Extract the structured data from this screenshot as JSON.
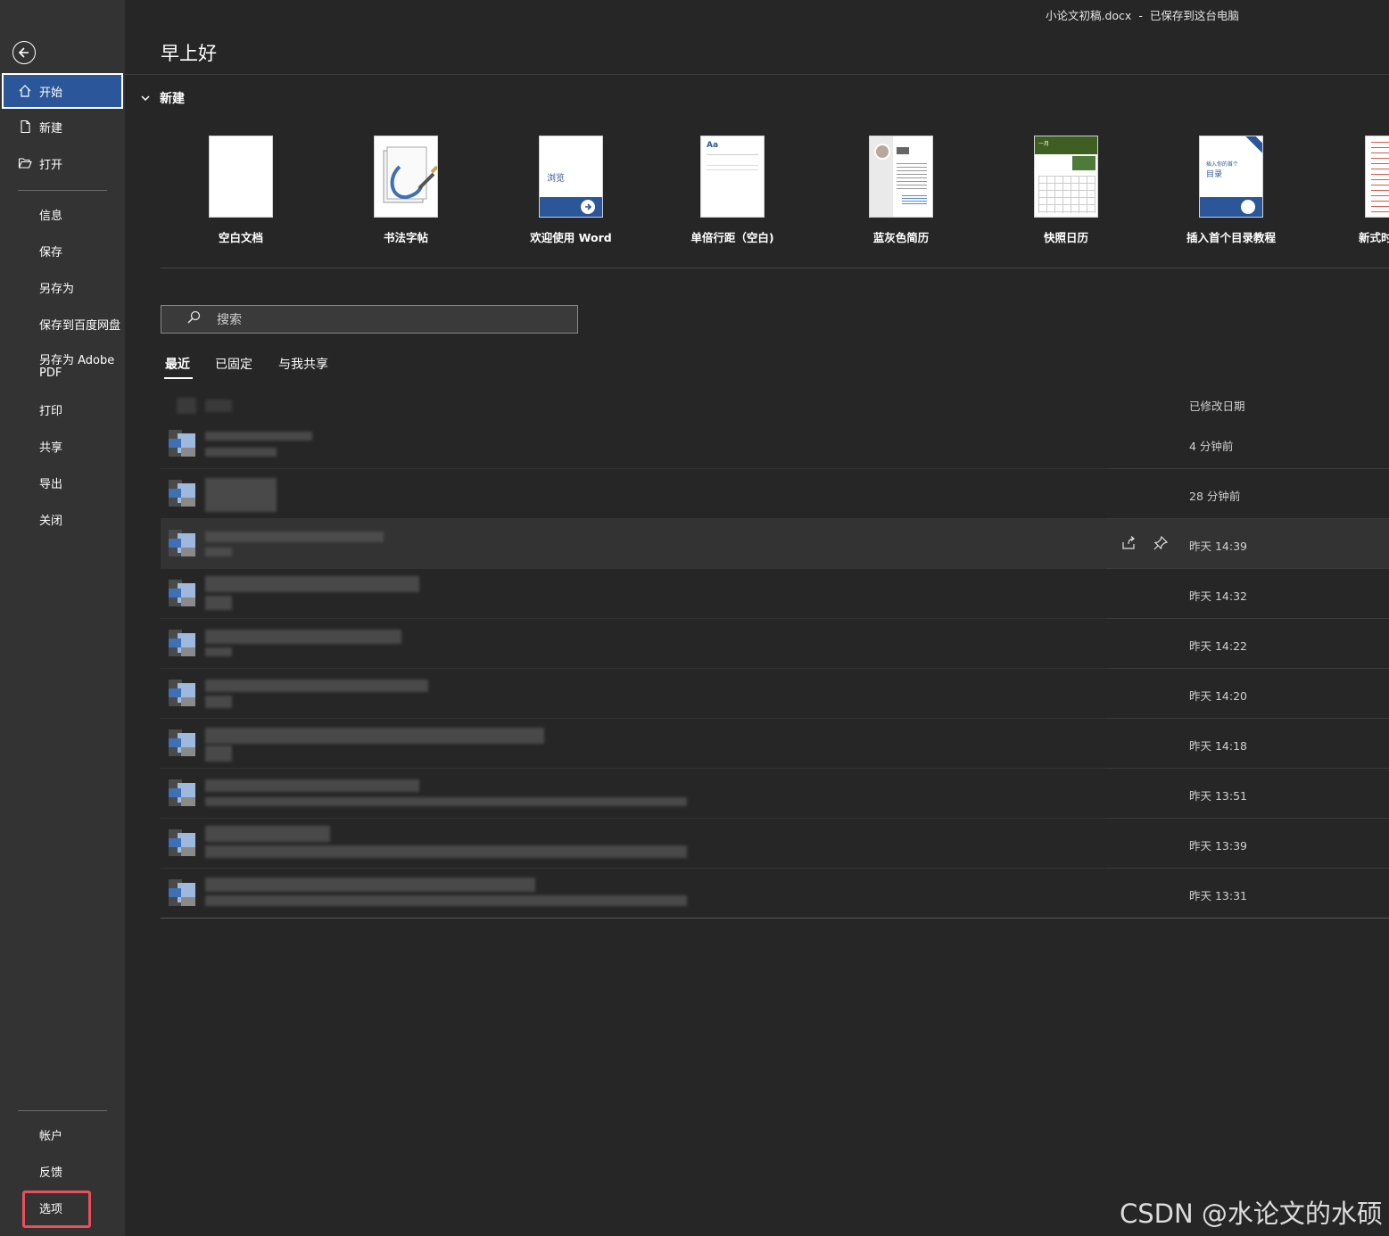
{
  "title_bar": {
    "filename": "小论文初稿.docx",
    "separator": "-",
    "status": "已保存到这台电脑"
  },
  "sidebar": {
    "items": [
      {
        "label": "开始",
        "icon": "home-icon"
      },
      {
        "label": "新建",
        "icon": "new-doc-icon"
      },
      {
        "label": "打开",
        "icon": "folder-open-icon"
      },
      {
        "label": "信息"
      },
      {
        "label": "保存"
      },
      {
        "label": "另存为"
      },
      {
        "label": "保存到百度网盘"
      },
      {
        "label": "另存为 Adobe PDF"
      },
      {
        "label": "打印"
      },
      {
        "label": "共享"
      },
      {
        "label": "导出"
      },
      {
        "label": "关闭"
      }
    ],
    "bottom": [
      {
        "label": "帐户"
      },
      {
        "label": "反馈"
      },
      {
        "label": "选项"
      }
    ]
  },
  "main": {
    "greeting": "早上好",
    "new_section": "新建",
    "templates": [
      {
        "name": "空白文档"
      },
      {
        "name": "书法字帖"
      },
      {
        "name": "欢迎使用 Word",
        "thumb_text": "浏览"
      },
      {
        "name": "单倍行距（空白)",
        "thumb_text": "Aa"
      },
      {
        "name": "蓝灰色简历"
      },
      {
        "name": "快照日历",
        "thumb_text": "一月"
      },
      {
        "name": "插入首个目录教程",
        "thumb_text": "插入你的首个",
        "thumb_text2": "目录"
      },
      {
        "name": "新式时"
      }
    ],
    "search_placeholder": "搜索",
    "tabs": [
      {
        "label": "最近"
      },
      {
        "label": "已固定"
      },
      {
        "label": "与我共享"
      }
    ],
    "column_header": "已修改日期",
    "files": [
      {
        "date": "4 分钟前"
      },
      {
        "date": "28 分钟前"
      },
      {
        "date": "昨天 14:39"
      },
      {
        "date": "昨天 14:32"
      },
      {
        "date": "昨天 14:22"
      },
      {
        "date": "昨天 14:20"
      },
      {
        "date": "昨天 14:18"
      },
      {
        "date": "昨天 13:51"
      },
      {
        "date": "昨天 13:39"
      },
      {
        "date": "昨天 13:31"
      }
    ]
  },
  "watermark": "CSDN @水论文的水硕",
  "colors": {
    "accent": "#2b579a",
    "highlight": "#e8505b",
    "background": "#262626",
    "sidebar": "#333333"
  }
}
